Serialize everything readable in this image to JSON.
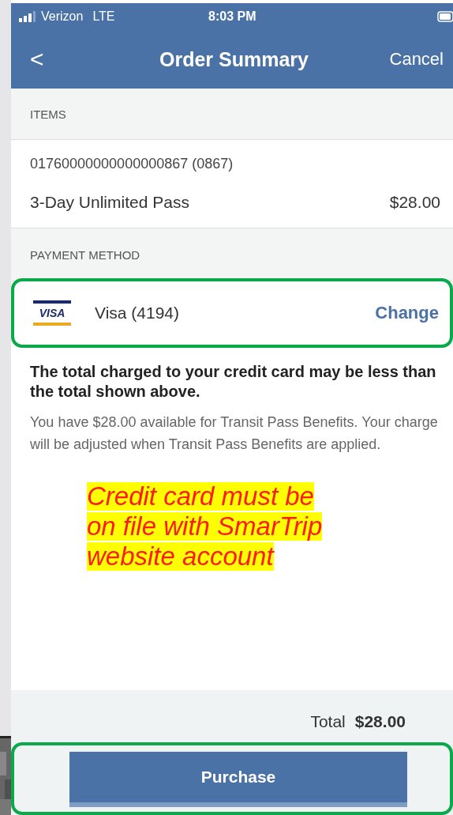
{
  "status_bar": {
    "carrier": "Verizon",
    "network": "LTE",
    "time": "8:03 PM"
  },
  "nav": {
    "back": "<",
    "title": "Order Summary",
    "cancel": "Cancel"
  },
  "items_section": {
    "header": "ITEMS",
    "card_number": "01760000000000000867 (0867)",
    "item_name": "3-Day Unlimited Pass",
    "item_price": "$28.00"
  },
  "payment_section": {
    "header": "PAYMENT METHOD",
    "card_label": "Visa (4194)",
    "card_logo": "VISA",
    "change": "Change",
    "highlighted": true
  },
  "notice": {
    "heading": "The total charged to your credit card may be less than the total shown above.",
    "body": "You have $28.00 available for Transit Pass Benefits. Your charge will be adjusted when Transit Pass Benefits are applied."
  },
  "annotation": {
    "lines": [
      "Credit card must be",
      "on file with SmarTrip",
      "website account"
    ]
  },
  "total": {
    "label": "Total",
    "amount": "$28.00"
  },
  "purchase": {
    "label": "Purchase",
    "highlighted": true
  }
}
